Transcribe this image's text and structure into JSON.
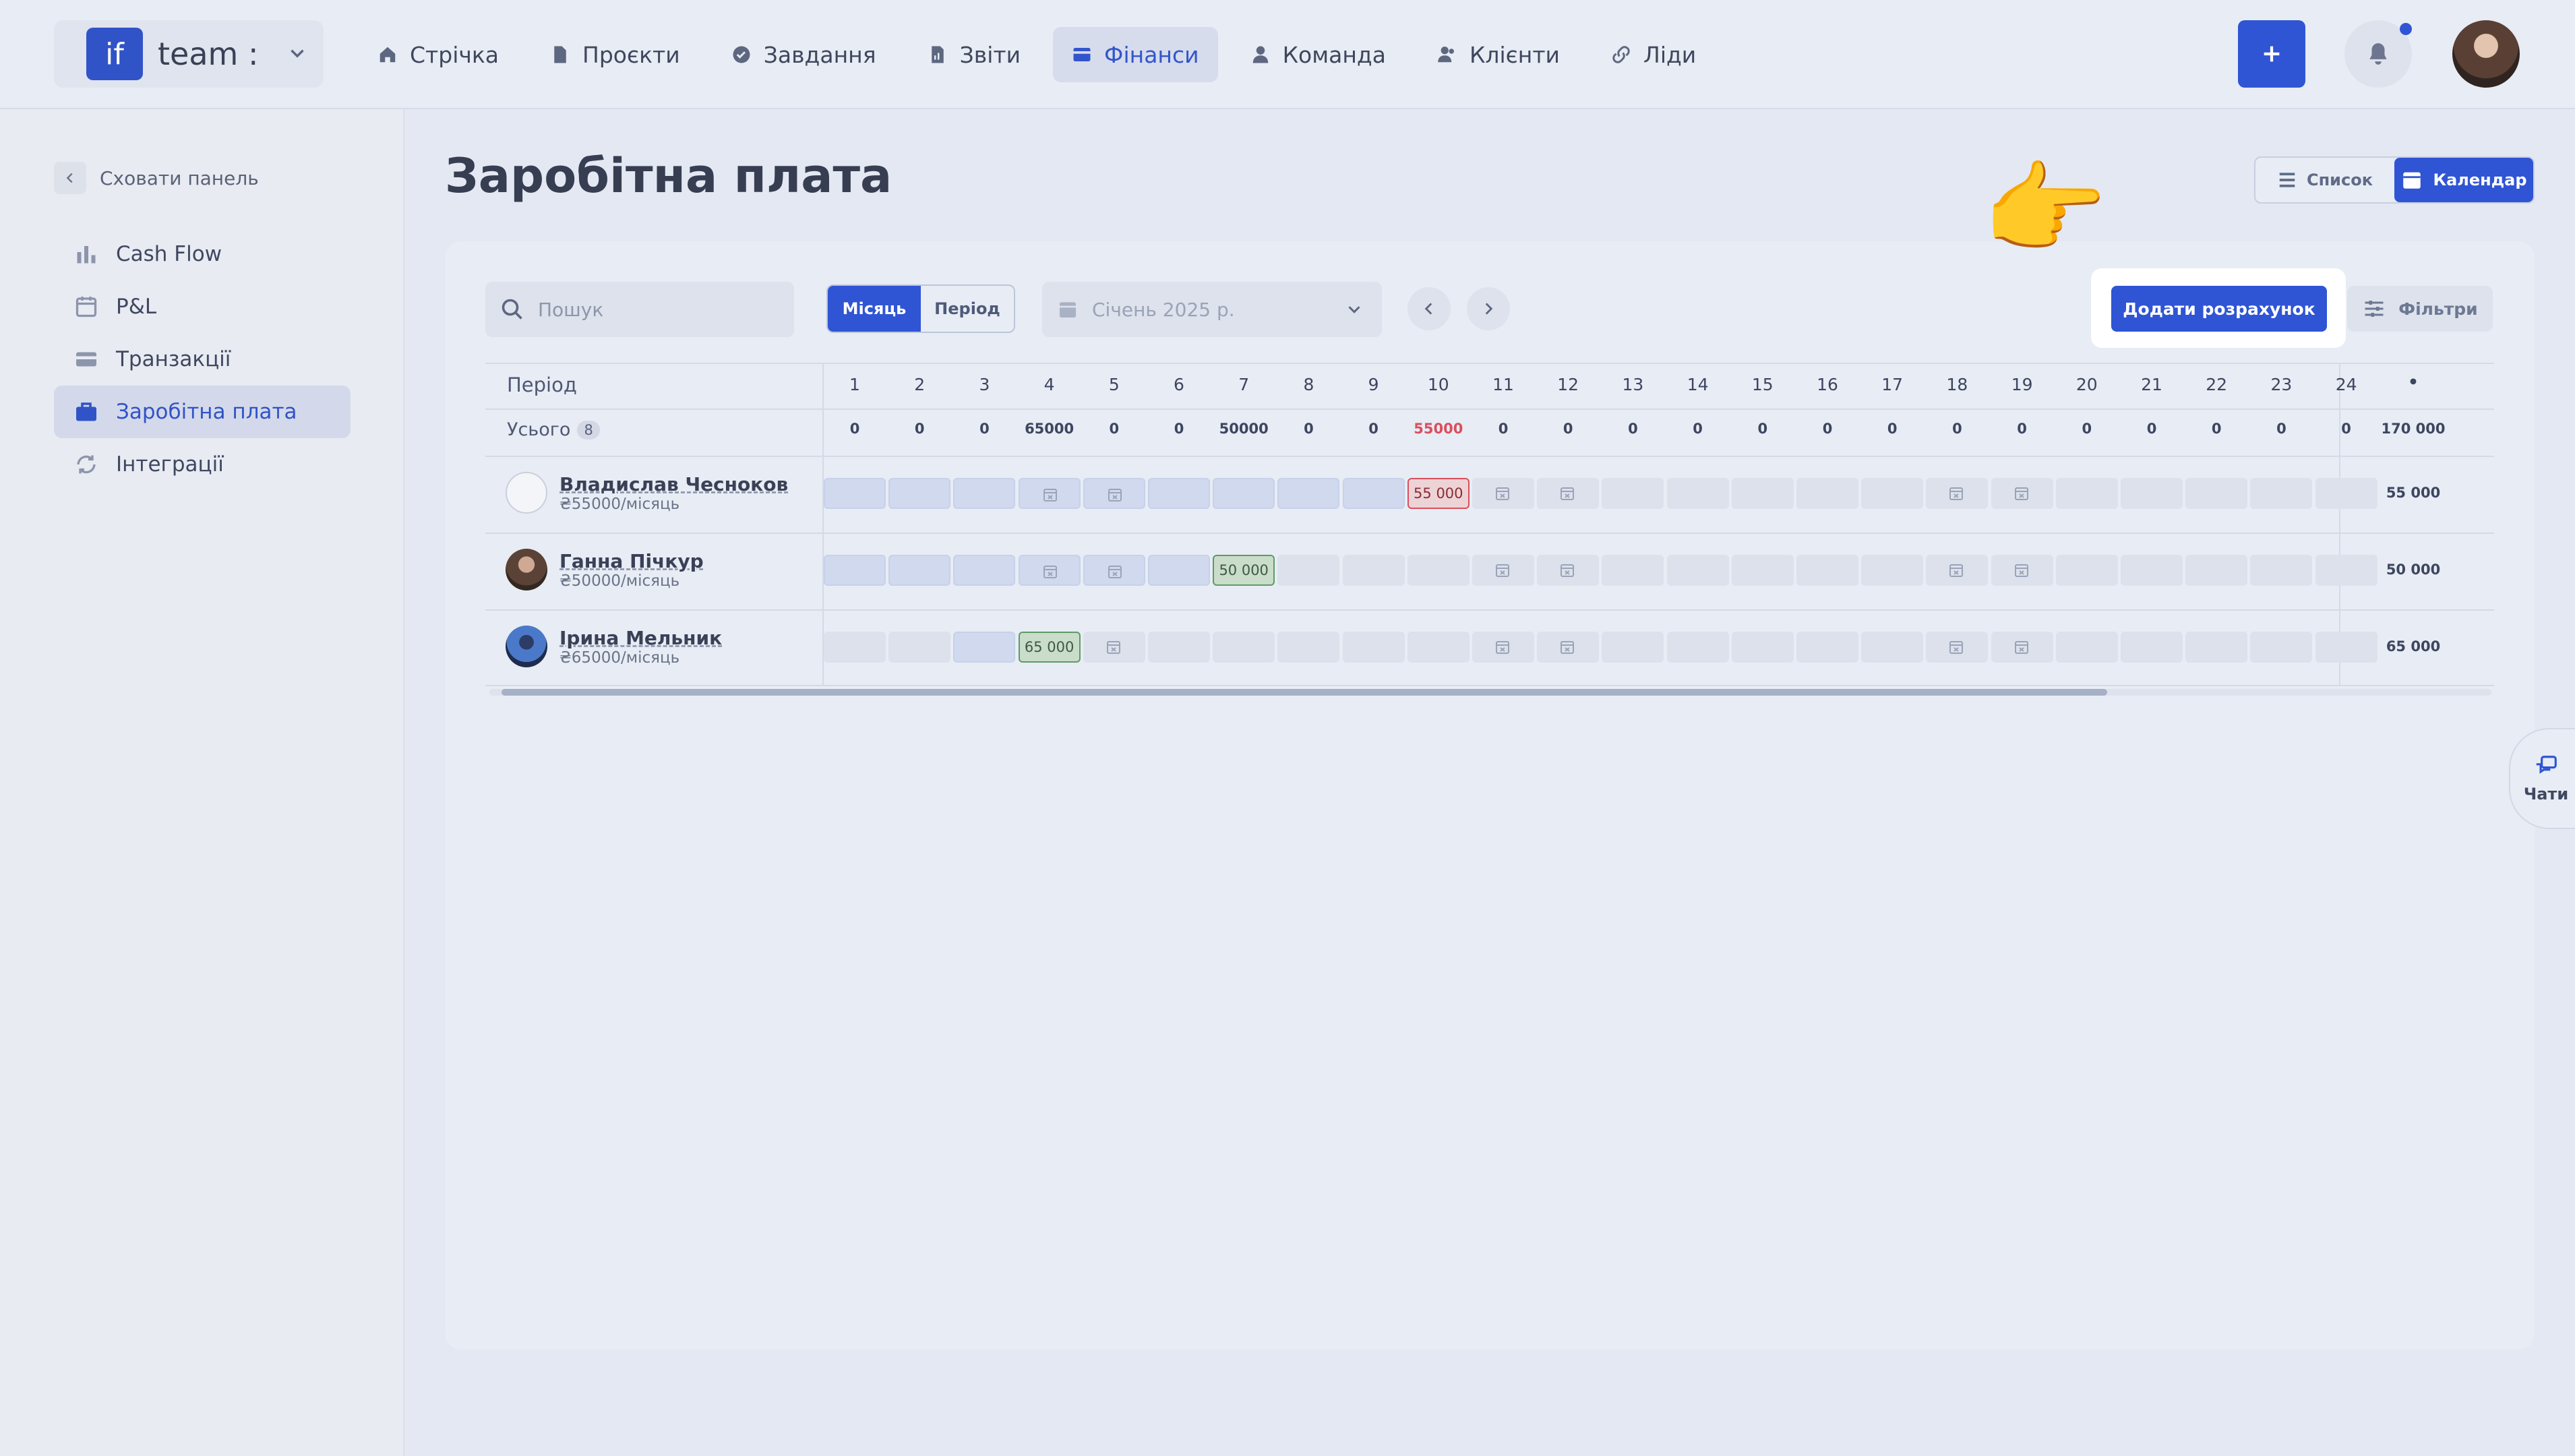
{
  "workspace": {
    "logo": "if",
    "name": "team :"
  },
  "nav": {
    "items": [
      {
        "label": "Стрічка",
        "icon": "home-icon"
      },
      {
        "label": "Проєкти",
        "icon": "document-icon"
      },
      {
        "label": "Завдання",
        "icon": "check-circle-icon"
      },
      {
        "label": "Звіти",
        "icon": "report-icon"
      },
      {
        "label": "Фінанси",
        "icon": "wallet-icon",
        "active": true
      },
      {
        "label": "Команда",
        "icon": "person-icon"
      },
      {
        "label": "Клієнти",
        "icon": "people-icon"
      },
      {
        "label": "Ліди",
        "icon": "link-icon"
      }
    ]
  },
  "sidebar": {
    "hide_label": "Сховати панель",
    "items": [
      {
        "label": "Cash Flow",
        "icon": "bar-chart-icon"
      },
      {
        "label": "P&L",
        "icon": "calendar-icon"
      },
      {
        "label": "Транзакції",
        "icon": "card-icon"
      },
      {
        "label": "Заробітна плата",
        "icon": "briefcase-icon",
        "active": true
      },
      {
        "label": "Інтеграції",
        "icon": "sync-icon"
      }
    ]
  },
  "page": {
    "title": "Заробітна плата"
  },
  "view": {
    "list": "Список",
    "calendar": "Календар",
    "active": "calendar"
  },
  "toolbar": {
    "search_placeholder": "Пошук",
    "mode_month": "Місяць",
    "mode_period": "Період",
    "date": "Січень 2025 р.",
    "add": "Додати розрахунок",
    "filters": "Фільтри"
  },
  "table": {
    "period_label": "Період",
    "total_label": "Усього",
    "total_count": "8",
    "days": [
      "1",
      "2",
      "3",
      "4",
      "5",
      "6",
      "7",
      "8",
      "9",
      "10",
      "11",
      "12",
      "13",
      "14",
      "15",
      "16",
      "17",
      "18",
      "19",
      "20",
      "21",
      "22",
      "23",
      "24"
    ],
    "sum_header": "•",
    "totals": [
      "0",
      "0",
      "0",
      "65000",
      "0",
      "0",
      "50000",
      "0",
      "0",
      "55000",
      "0",
      "0",
      "0",
      "0",
      "0",
      "0",
      "0",
      "0",
      "0",
      "0",
      "0",
      "0",
      "0",
      "0"
    ],
    "grand_total": "170 000",
    "rows": [
      {
        "name": "Владислав Чесноков",
        "rate": "₴55000/місяць",
        "payment": "55 000",
        "payment_day": 10,
        "sum": "55 000"
      },
      {
        "name": "Ганна Пічкур",
        "rate": "₴50000/місяць",
        "payment": "50 000",
        "payment_day": 7,
        "sum": "50 000"
      },
      {
        "name": "Ірина Мельник",
        "rate": "₴65000/місяць",
        "payment": "65 000",
        "payment_day": 4,
        "sum": "65 000"
      }
    ]
  },
  "chat": {
    "label": "Чати"
  },
  "colors": {
    "accent": "#2f55d4",
    "paid": "#5f9a68",
    "overdue": "#d8505d"
  }
}
